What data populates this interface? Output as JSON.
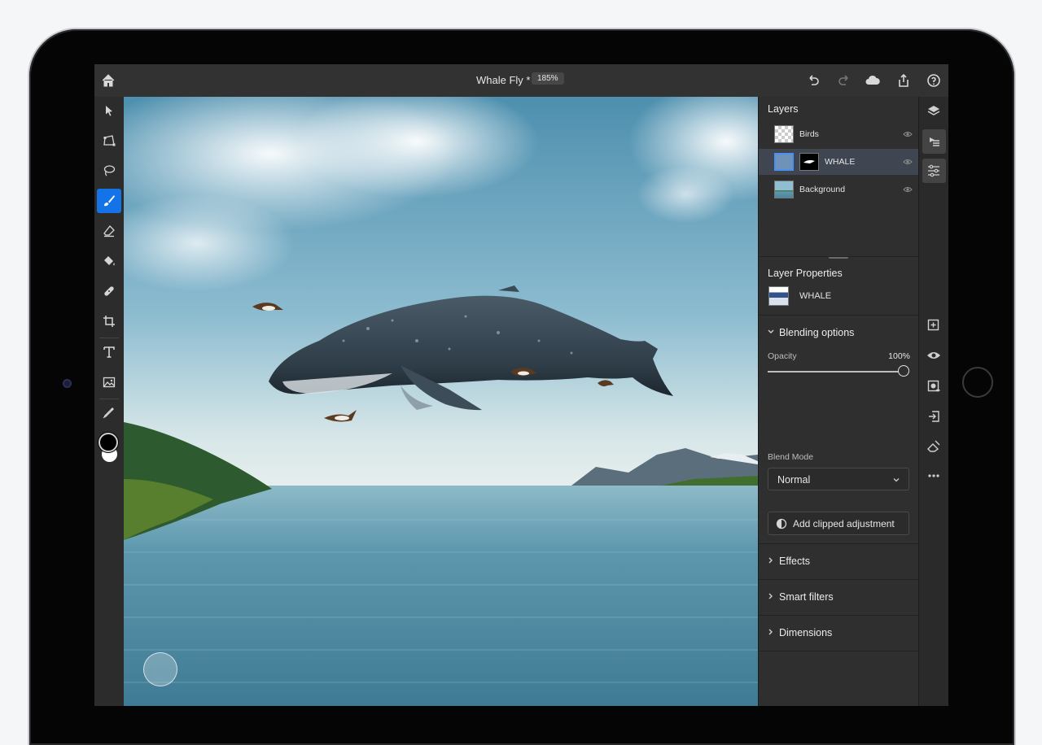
{
  "topbar": {
    "home": "home-icon",
    "document_title": "Whale Fly *",
    "zoom_level": "185%",
    "actions": [
      "undo-icon",
      "redo-icon",
      "cloud-icon",
      "share-icon",
      "help-icon"
    ]
  },
  "tools": [
    "select",
    "transform",
    "lasso",
    "brush",
    "eraser",
    "fill",
    "healing",
    "crop",
    "type",
    "place-image",
    "eyedropper"
  ],
  "active_tool": "brush",
  "colors": {
    "accent": "#1473e6",
    "foreground_swatch": "#000000",
    "background_swatch": "#ffffff"
  },
  "layers_panel": {
    "title": "Layers",
    "layers": [
      {
        "name": "Birds",
        "selected": false
      },
      {
        "name": "WHALE",
        "selected": true
      },
      {
        "name": "Background",
        "selected": false
      }
    ]
  },
  "layer_properties": {
    "title": "Layer Properties",
    "layer_name": "WHALE"
  },
  "blending": {
    "title": "Blending options",
    "opacity_label": "Opacity",
    "opacity_value": "100%",
    "opacity_fraction": 1.0,
    "blend_mode_label": "Blend Mode",
    "blend_mode": "Normal"
  },
  "clipped_button": "Add clipped adjustment",
  "sections": {
    "effects": "Effects",
    "smart_filters": "Smart filters",
    "dimensions": "Dimensions"
  },
  "right_toolbar": [
    "layers-icon",
    "layer-properties-icon",
    "adjustments-icon",
    "add-layer-icon",
    "visibility-icon",
    "mask-icon",
    "import-icon",
    "eraser-layer-icon",
    "more-icon"
  ]
}
